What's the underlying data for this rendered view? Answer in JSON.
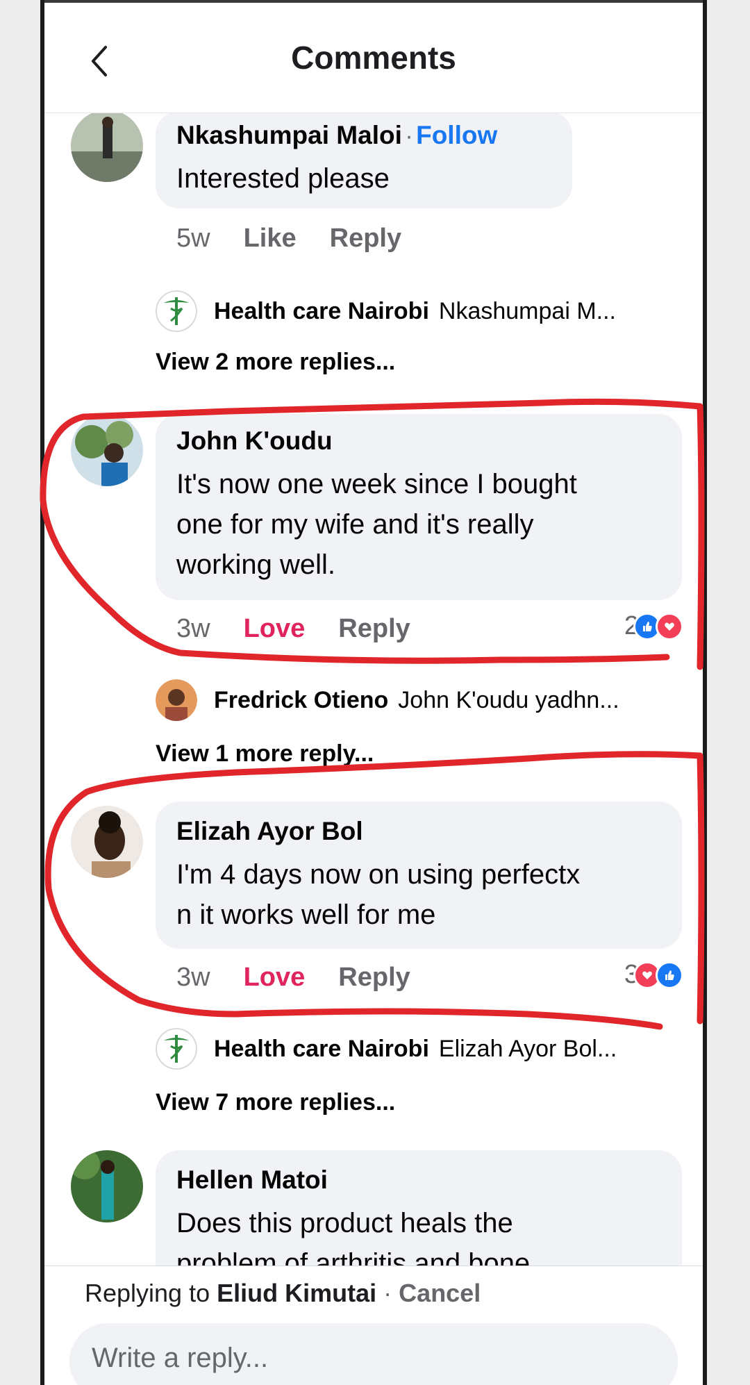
{
  "header": {
    "title": "Comments"
  },
  "comments": [
    {
      "name": "Nkashumpai Maloi",
      "follow": "Follow",
      "separator": "·",
      "lines": [
        "Interested please"
      ],
      "time": "5w",
      "action": "Like",
      "reply": "Reply",
      "reply_preview": {
        "name": "Health care Nairobi",
        "text": "Nkashumpai M..."
      },
      "view_more": "View 2 more replies..."
    },
    {
      "name": "John K'oudu",
      "lines": [
        "It's now one week since I bought",
        "one for my wife and it's really",
        "working well."
      ],
      "time": "3w",
      "action": "Love",
      "reply": "Reply",
      "reaction_count": "2",
      "reply_preview": {
        "name": "Fredrick Otieno",
        "text": "John K'oudu yadhn..."
      },
      "view_more": "View 1 more reply..."
    },
    {
      "name": "Elizah Ayor Bol",
      "lines": [
        "I'm 4 days now on using perfectx",
        "n it works well for me"
      ],
      "time": "3w",
      "action": "Love",
      "reply": "Reply",
      "reaction_count": "3",
      "reply_preview": {
        "name": "Health care Nairobi",
        "text": "Elizah Ayor Bol..."
      },
      "view_more": "View 7 more replies..."
    },
    {
      "name": "Hellen Matoi",
      "lines": [
        "Does this product heals the",
        "problem of arthritis and bone"
      ]
    }
  ],
  "composer": {
    "replying_prefix": "Replying to",
    "replying_name": "Eliud Kimutai",
    "separator": "·",
    "cancel": "Cancel",
    "placeholder": "Write a reply..."
  },
  "colors": {
    "accent": "#1877f2",
    "love": "#e0245e",
    "highlight": "#e0262a",
    "bubble": "#f0f2f5"
  }
}
